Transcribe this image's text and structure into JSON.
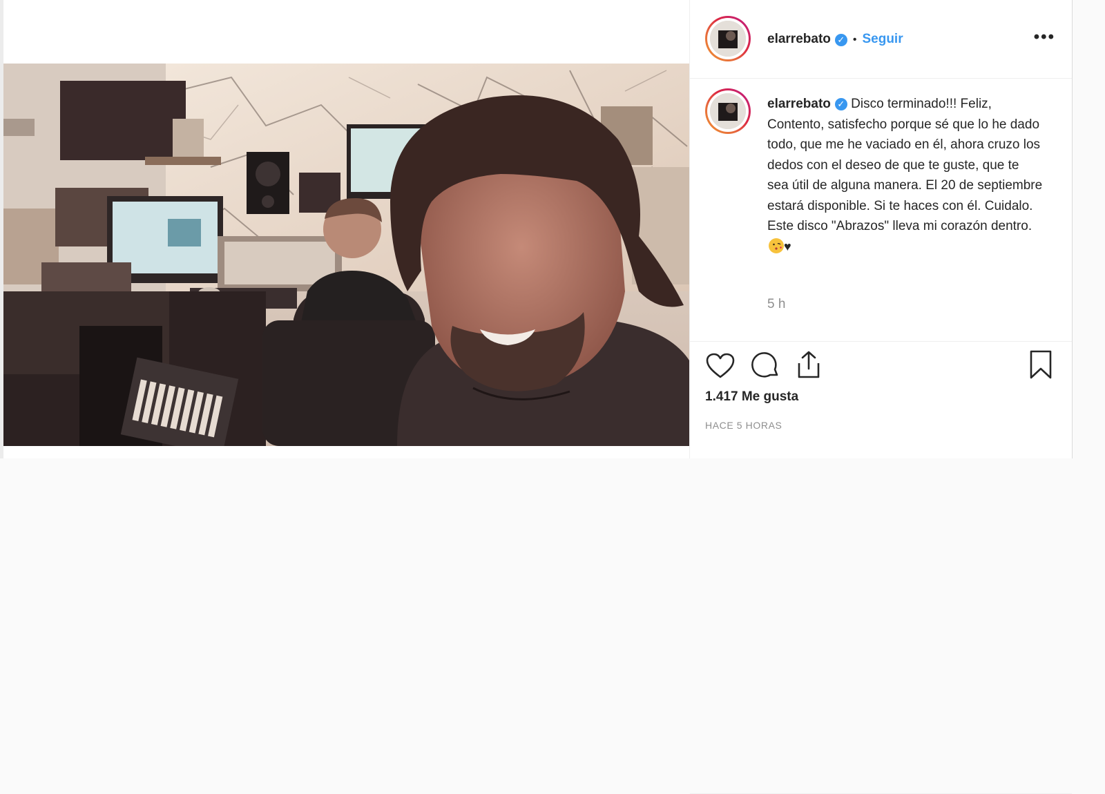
{
  "post": {
    "username": "elarrebato",
    "verified_icon": "verified-badge-icon",
    "separator": "•",
    "follow_label": "Seguir",
    "more_label": "•••",
    "caption_username": "elarrebato",
    "caption_text": "Disco terminado!!! Feliz, Contento, satisfecho porque sé que lo he dado todo, que me he vaciado en él, ahora cruzo los dedos con el deseo de que te guste, que te sea útil de alguna manera. El 20 de septiembre estará disponible. Si te haces con él. Cuidalo. Este disco \"Abrazos\" lleva mi corazón dentro.",
    "caption_heart": "♥",
    "comment_time": "5 h",
    "likes": "1.417 Me gusta",
    "posted_ago": "HACE 5 HORAS"
  },
  "icons": {
    "like": "heart-icon",
    "comment": "comment-icon",
    "share": "share-icon",
    "save": "bookmark-icon"
  },
  "colors": {
    "accent": "#3897f0",
    "text": "#262626",
    "muted": "#8e8e8e",
    "border": "#efefef"
  }
}
